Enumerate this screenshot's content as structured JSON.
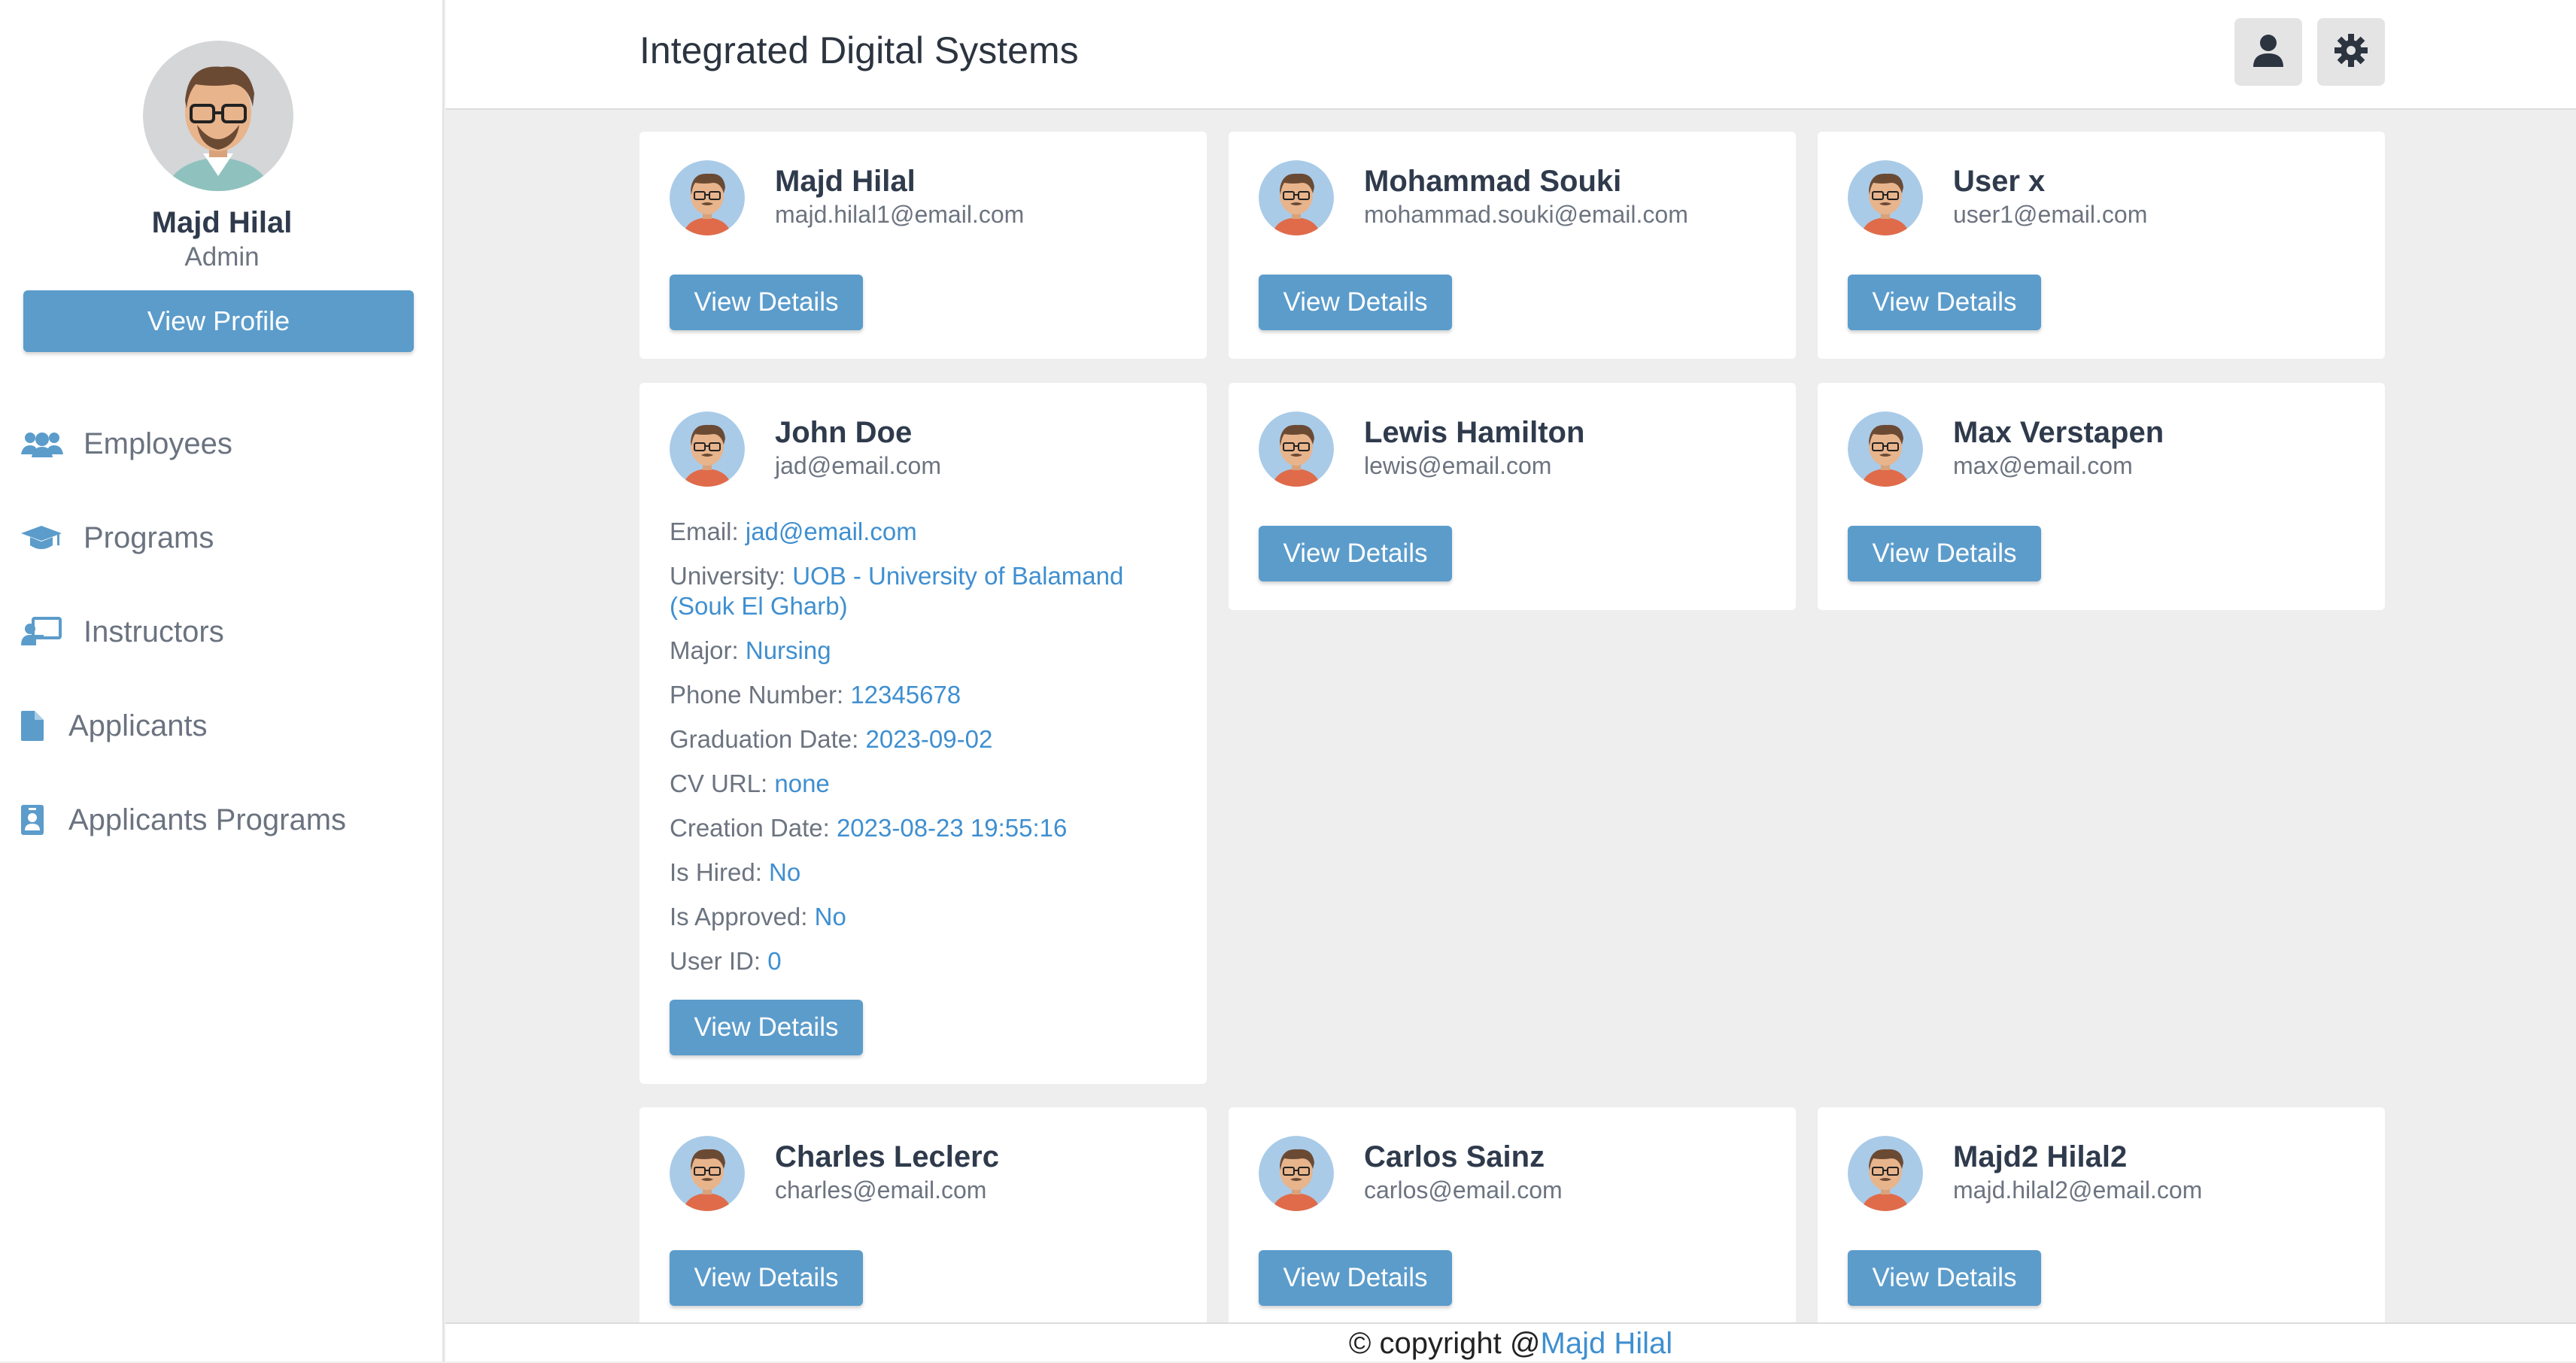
{
  "sidebar": {
    "profile": {
      "name": "Majd Hilal",
      "role": "Admin",
      "view_profile_label": "View Profile"
    },
    "nav": [
      {
        "label": "Employees",
        "icon": "users-icon"
      },
      {
        "label": "Programs",
        "icon": "graduation-cap-icon"
      },
      {
        "label": "Instructors",
        "icon": "chalkboard-teacher-icon"
      },
      {
        "label": "Applicants",
        "icon": "file-icon"
      },
      {
        "label": "Applicants Programs",
        "icon": "id-badge-icon"
      }
    ]
  },
  "header": {
    "title": "Integrated Digital Systems",
    "user_icon": "user-icon",
    "settings_icon": "gear-icon"
  },
  "cards": [
    {
      "name": "Majd Hilal",
      "email": "majd.hilal1@email.com",
      "button": "View Details"
    },
    {
      "name": "Mohammad Souki",
      "email": "mohammad.souki@email.com",
      "button": "View Details"
    },
    {
      "name": "User x",
      "email": "user1@email.com",
      "button": "View Details"
    },
    {
      "name": "John Doe",
      "email": "jad@email.com",
      "button": "View Details",
      "details": [
        {
          "label": "Email:",
          "value": "jad@email.com"
        },
        {
          "label": "University:",
          "value": "UOB - University of Balamand (Souk El Gharb)"
        },
        {
          "label": "Major:",
          "value": "Nursing"
        },
        {
          "label": "Phone Number:",
          "value": "12345678"
        },
        {
          "label": "Graduation Date:",
          "value": "2023-09-02"
        },
        {
          "label": "CV URL:",
          "value": "none"
        },
        {
          "label": "Creation Date:",
          "value": "2023-08-23 19:55:16"
        },
        {
          "label": "Is Hired:",
          "value": "No"
        },
        {
          "label": "Is Approved:",
          "value": "No"
        },
        {
          "label": "User ID:",
          "value": "0"
        }
      ]
    },
    {
      "name": "Lewis Hamilton",
      "email": "lewis@email.com",
      "button": "View Details"
    },
    {
      "name": "Max Verstapen",
      "email": "max@email.com",
      "button": "View Details"
    },
    {
      "name": "Charles Leclerc",
      "email": "charles@email.com",
      "button": "View Details"
    },
    {
      "name": "Carlos Sainz",
      "email": "carlos@email.com",
      "button": "View Details"
    },
    {
      "name": "Majd2 Hilal2",
      "email": "majd.hilal2@email.com",
      "button": "View Details"
    }
  ],
  "footer": {
    "prefix": "© copyright @",
    "author": "Majd Hilal"
  },
  "colors": {
    "accent": "#5b9ccb",
    "link": "#3f8fd0",
    "background": "#eeeeee"
  }
}
